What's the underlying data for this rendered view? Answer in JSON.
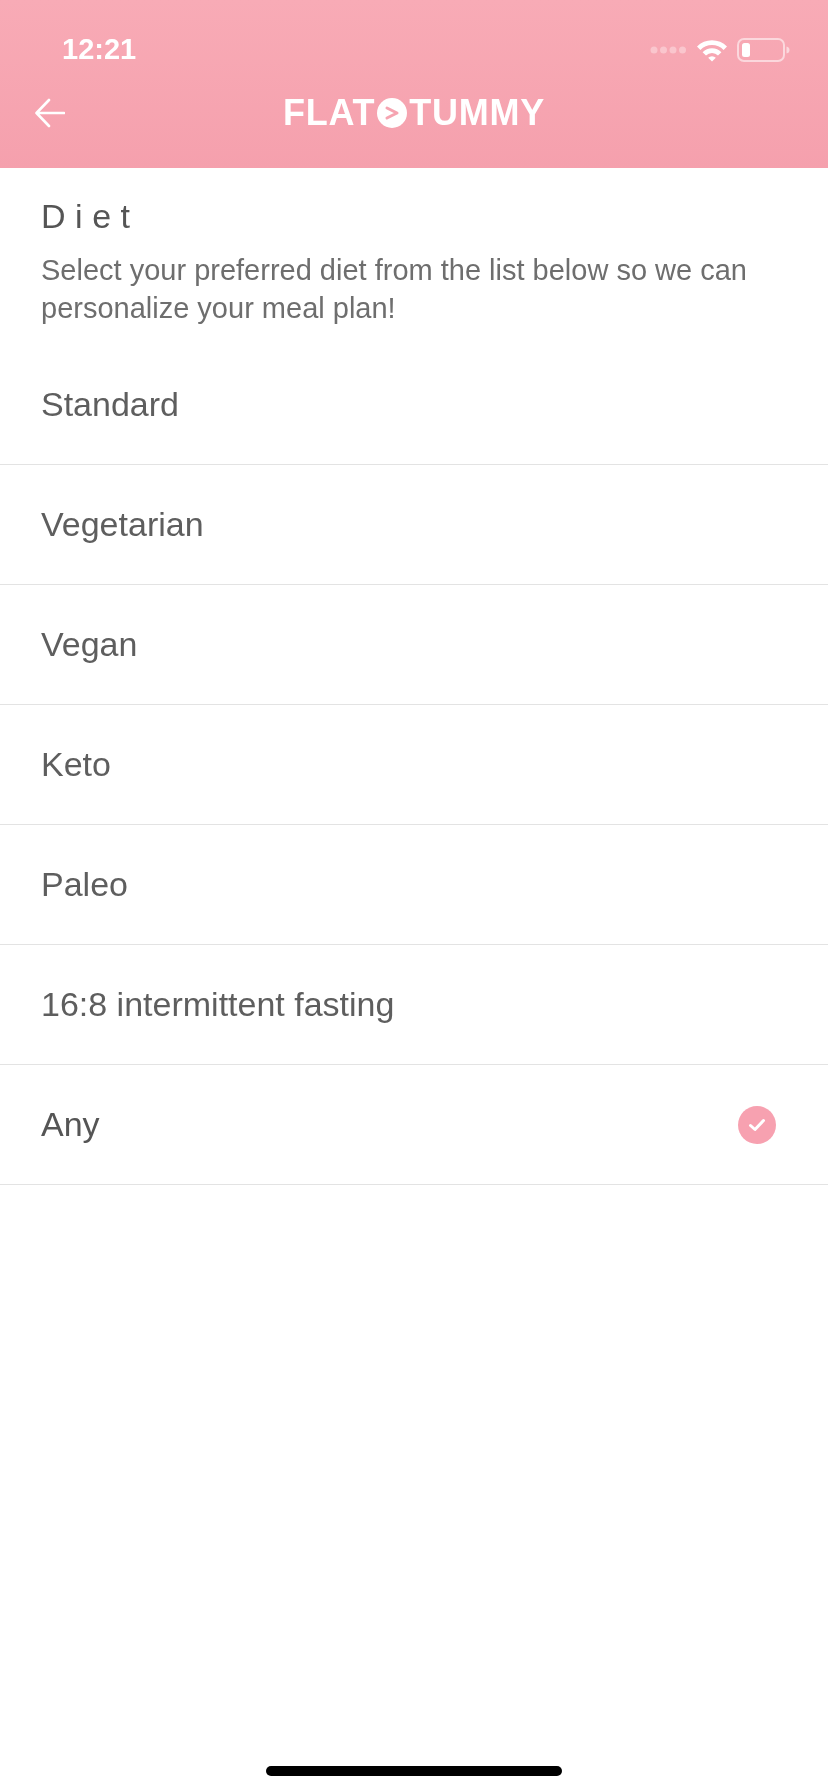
{
  "status_bar": {
    "time": "12:21"
  },
  "header": {
    "logo": {
      "left": "FLAT",
      "right": "TUMMY"
    }
  },
  "page": {
    "title": "Diet",
    "description": "Select your preferred diet from the list below so we can personalize your meal plan!"
  },
  "diets": [
    {
      "label": "Standard",
      "selected": false
    },
    {
      "label": "Vegetarian",
      "selected": false
    },
    {
      "label": "Vegan",
      "selected": false
    },
    {
      "label": "Keto",
      "selected": false
    },
    {
      "label": "Paleo",
      "selected": false
    },
    {
      "label": "16:8 intermittent fasting",
      "selected": false
    },
    {
      "label": "Any",
      "selected": true
    }
  ]
}
